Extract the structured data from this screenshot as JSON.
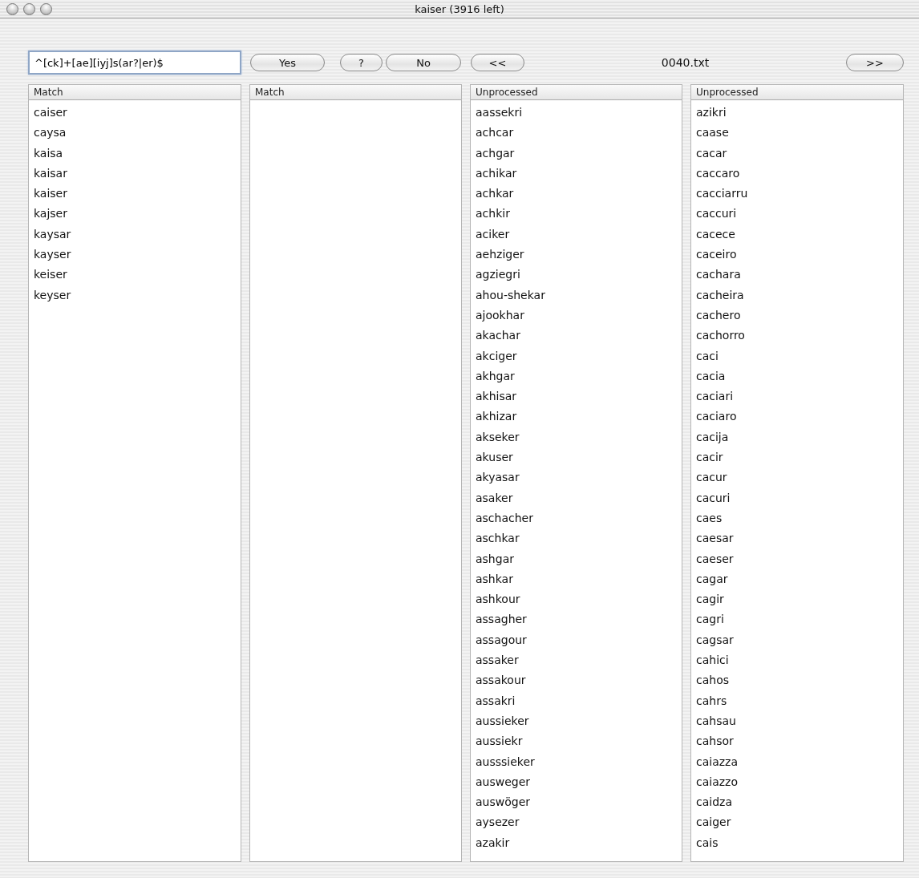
{
  "window": {
    "title": "kaiser (3916 left)"
  },
  "toolbar": {
    "pattern": {
      "value": "^[ck]+[ae][iyj]s(ar?|er)$"
    },
    "buttons": [
      {
        "kind": "yes",
        "label": "Yes"
      },
      {
        "kind": "help",
        "label": "?"
      },
      {
        "kind": "no",
        "label": "No"
      },
      {
        "kind": "prev",
        "label": "<<"
      }
    ],
    "file": "0040.txt",
    "next_button": {
      "label": ">>"
    }
  },
  "lists": [
    {
      "header": "Match",
      "items": [
        "caiser",
        "caysa",
        "kaisa",
        "kaisar",
        "kaiser",
        "kajser",
        "kaysar",
        "kayser",
        "keiser",
        "keyser"
      ]
    },
    {
      "header": "Match"
    },
    {
      "header": "Unprocessed",
      "items": [
        "aassekri",
        "achcar",
        "achgar",
        "achikar",
        "achkar",
        "achkir",
        "aciker",
        "aehziger",
        "agziegri",
        "ahou-shekar",
        "ajookhar",
        "akachar",
        "akciger",
        "akhgar",
        "akhisar",
        "akhizar",
        "akseker",
        "akuser",
        "akyasar",
        "asaker",
        "aschacher",
        "aschkar",
        "ashgar",
        "ashkar",
        "ashkour",
        "assagher",
        "assagour",
        "assaker",
        "assakour",
        "assakri",
        "aussieker",
        "aussiekr",
        "ausssieker",
        "ausweger",
        "auswöger",
        "aysezer",
        "azakir"
      ]
    },
    {
      "header": "Unprocessed",
      "items": [
        "azikri",
        "caase",
        "cacar",
        "caccaro",
        "cacciarru",
        "caccuri",
        "cacece",
        "caceiro",
        "cachara",
        "cacheira",
        "cachero",
        "cachorro",
        "caci",
        "cacia",
        "caciari",
        "caciaro",
        "cacija",
        "cacir",
        "cacur",
        "cacuri",
        "caes",
        "caesar",
        "caeser",
        "cagar",
        "cagir",
        "cagri",
        "cagsar",
        "cahici",
        "cahos",
        "cahrs",
        "cahsau",
        "cahsor",
        "caiazza",
        "caiazzo",
        "caidza",
        "caiger",
        "cais"
      ]
    }
  ]
}
